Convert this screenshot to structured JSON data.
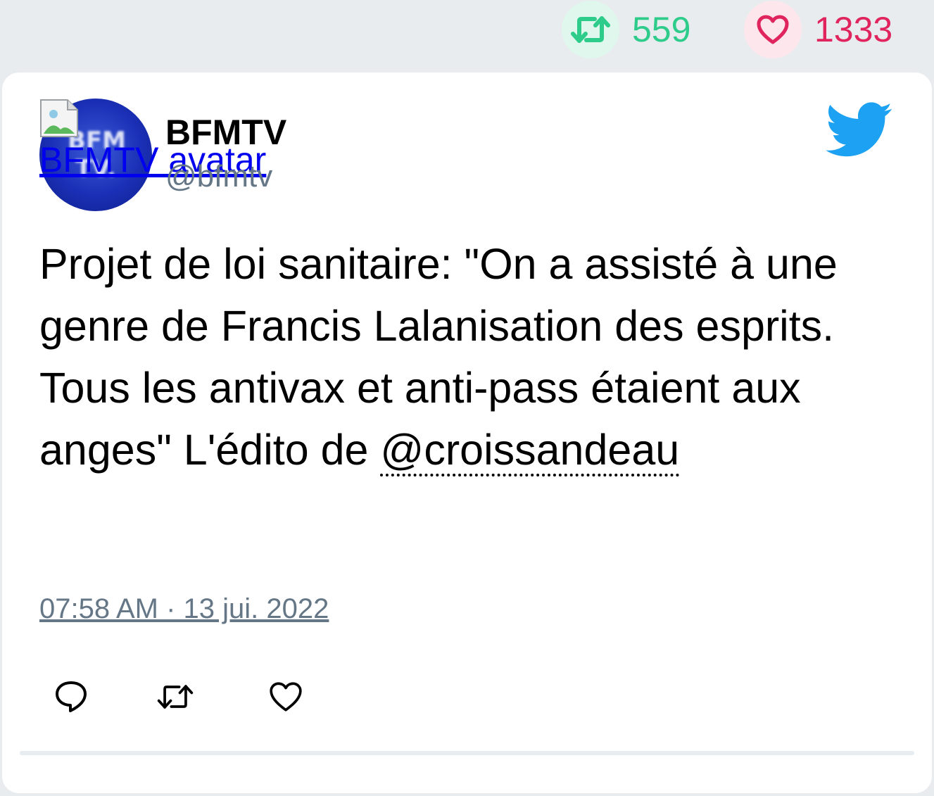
{
  "stats": {
    "retweet_count": "559",
    "like_count": "1333",
    "retweet_color": "#2ecc8a",
    "like_color": "#e0245e"
  },
  "tweet": {
    "avatar_alt": "BFMTV avatar",
    "avatar_logo_text": "BFM TV.",
    "display_name": "BFMTV",
    "handle": "@bfmtv",
    "text_before_mention": "Projet de loi sanitaire: \"On a assisté à une genre de Francis Lalanisation des esprits. Tous les antivax et anti-pass étaient aux anges\" L'édito de ",
    "mention": "@croissandeau",
    "timestamp": "07:58 AM · 13 jui. 2022",
    "brand_icon": "twitter-bird-icon",
    "brand_color": "#1da1f2"
  },
  "actions": {
    "reply_icon": "reply-icon",
    "retweet_icon": "retweet-icon",
    "like_icon": "heart-icon"
  }
}
